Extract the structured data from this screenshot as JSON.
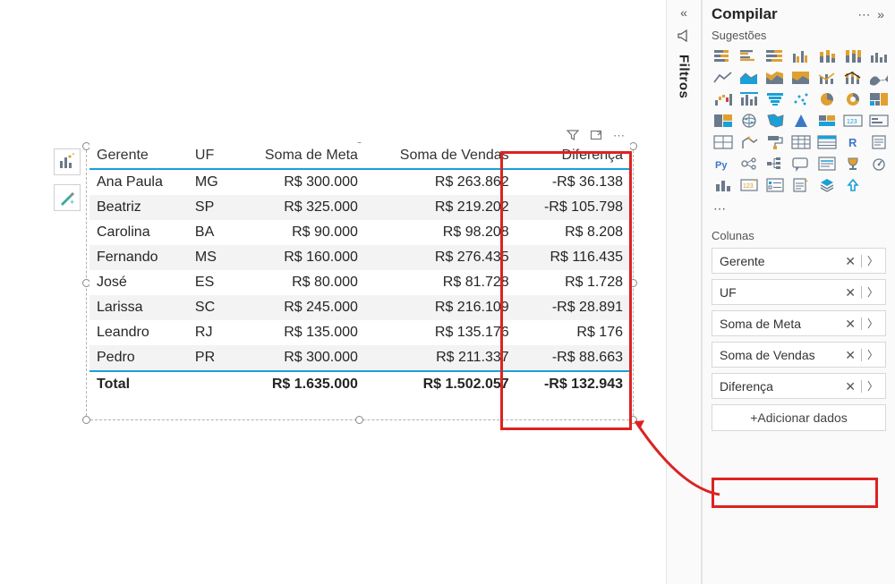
{
  "panel": {
    "title": "Compilar",
    "suggestions_label": "Sugestões",
    "columns_label": "Colunas",
    "add_data_label": "+Adicionar dados",
    "fields": [
      {
        "name": "Gerente"
      },
      {
        "name": "UF"
      },
      {
        "name": "Soma de Meta"
      },
      {
        "name": "Soma de Vendas"
      },
      {
        "name": "Diferença"
      }
    ]
  },
  "filters_rail": {
    "label": "Filtros"
  },
  "table": {
    "headers": {
      "gerente": "Gerente",
      "uf": "UF",
      "meta": "Soma de Meta",
      "vendas": "Soma de Vendas",
      "dif": "Diferença"
    },
    "rows": [
      {
        "gerente": "Ana Paula",
        "uf": "MG",
        "meta": "R$ 300.000",
        "vendas": "R$ 263.862",
        "dif": "-R$ 36.138"
      },
      {
        "gerente": "Beatriz",
        "uf": "SP",
        "meta": "R$ 325.000",
        "vendas": "R$ 219.202",
        "dif": "-R$ 105.798"
      },
      {
        "gerente": "Carolina",
        "uf": "BA",
        "meta": "R$ 90.000",
        "vendas": "R$ 98.208",
        "dif": "R$ 8.208"
      },
      {
        "gerente": "Fernando",
        "uf": "MS",
        "meta": "R$ 160.000",
        "vendas": "R$ 276.435",
        "dif": "R$ 116.435"
      },
      {
        "gerente": "José",
        "uf": "ES",
        "meta": "R$ 80.000",
        "vendas": "R$ 81.728",
        "dif": "R$ 1.728"
      },
      {
        "gerente": "Larissa",
        "uf": "SC",
        "meta": "R$ 245.000",
        "vendas": "R$ 216.109",
        "dif": "-R$ 28.891"
      },
      {
        "gerente": "Leandro",
        "uf": "RJ",
        "meta": "R$ 135.000",
        "vendas": "R$ 135.176",
        "dif": "R$ 176"
      },
      {
        "gerente": "Pedro",
        "uf": "PR",
        "meta": "R$ 300.000",
        "vendas": "R$ 211.337",
        "dif": "-R$ 88.663"
      }
    ],
    "total": {
      "label": "Total",
      "meta": "R$ 1.635.000",
      "vendas": "R$ 1.502.057",
      "dif": "-R$ 132.943"
    }
  },
  "viz_icons": [
    "stacked-bar",
    "clustered-bar",
    "stacked-bar-100",
    "clustered-column",
    "stacked-column",
    "stacked-column-100",
    "clustered-column-line",
    "line",
    "area",
    "stacked-area",
    "area-100",
    "line-column",
    "line-stacked",
    "ribbon",
    "waterfall",
    "funnel-col",
    "funnel",
    "scatter",
    "pie",
    "donut",
    "treemap",
    "map-tree",
    "map-globe",
    "filled-map",
    "azure-map",
    "shape-map",
    "card-123",
    "card",
    "multi-row",
    "kpi",
    "paint-roller",
    "matrix",
    "table",
    "r-visual",
    "paginated",
    "py-visual",
    "key-influencers",
    "decomposition",
    "qa",
    "narrative",
    "goals",
    "metrics",
    "column-simple",
    "smart-narrative",
    "slicer",
    "paginated-2",
    "app",
    "get-visuals"
  ],
  "colors": {
    "slate": "#6b7a8a",
    "amber": "#e0a030",
    "teal": "#1aa0d8",
    "blue": "#3a78c8"
  }
}
